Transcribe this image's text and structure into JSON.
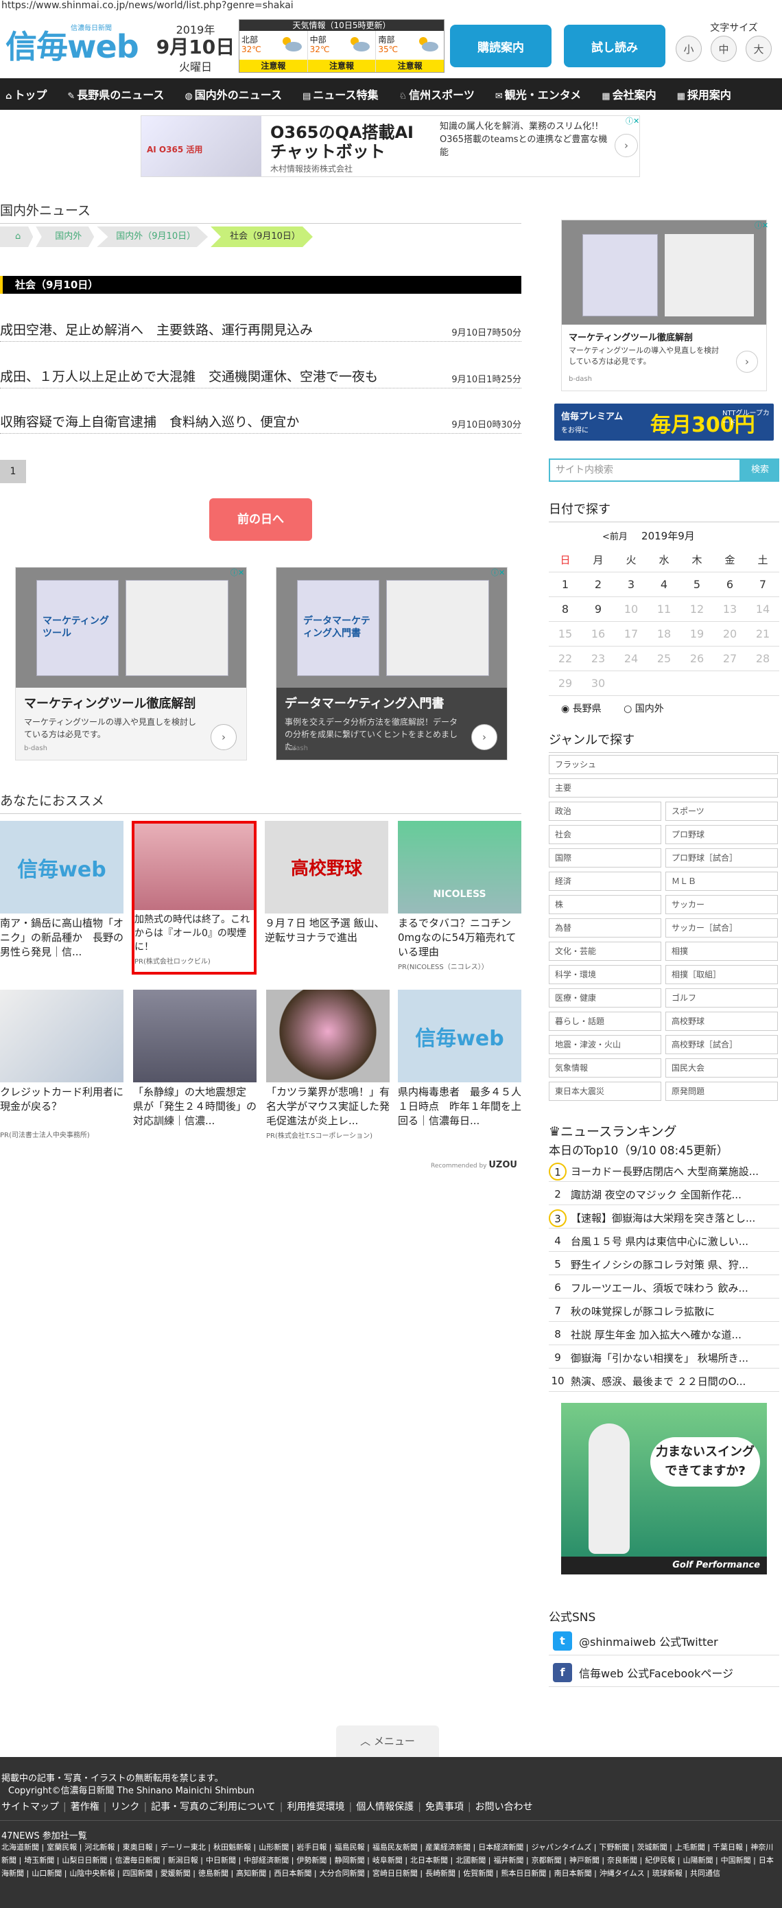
{
  "url": "https://www.shinmai.co.jp/news/world/list.php?genre=shakai",
  "header": {
    "logo_small": "信濃毎日新聞",
    "logo_big": "信毎web",
    "year": "2019年",
    "monthday": "9月10日",
    "weekday": "火曜日",
    "weather_title": "天気情報（10日5時更新）",
    "weather": [
      {
        "area": "北部",
        "temp": "32℃",
        "warn": "注意報"
      },
      {
        "area": "中部",
        "temp": "32℃",
        "warn": "注意報"
      },
      {
        "area": "南部",
        "temp": "35℃",
        "warn": "注意報"
      }
    ],
    "btn_subscribe": "購読案内",
    "btn_trial": "試し読み",
    "font_size_label": "文字サイズ",
    "font_sizes": [
      "小",
      "中",
      "大"
    ]
  },
  "nav": [
    {
      "icon": "home-icon",
      "label": "トップ"
    },
    {
      "icon": "news-icon",
      "label": "長野県のニュース"
    },
    {
      "icon": "globe-icon",
      "label": "国内外のニュース"
    },
    {
      "icon": "doc-icon",
      "label": "ニュース特集"
    },
    {
      "icon": "sports-icon",
      "label": "信州スポーツ"
    },
    {
      "icon": "camera-icon",
      "label": "観光・エンタメ"
    },
    {
      "icon": "building-icon",
      "label": "会社案内"
    },
    {
      "icon": "people-icon",
      "label": "採用案内"
    }
  ],
  "top_ad": {
    "title_l1": "O365のQA搭載AI",
    "title_l2": "チャットボット",
    "company": "木村情報技術株式会社",
    "desc": "知識の属人化を解消、業務のスリム化!!　O365搭載のteamsとの連携など豊富な機能",
    "img_text": "AI O365 活用"
  },
  "main": {
    "section_title": "国内外ニュース",
    "breadcrumb": [
      "国内外",
      "国内外（9月10日）",
      "社会（9月10日）"
    ],
    "genre_header": "社会（9月10日）",
    "articles": [
      {
        "title": "成田空港、足止め解消へ　主要鉄路、運行再開見込み",
        "date": "9月10日7時50分"
      },
      {
        "title": "成田、１万人以上足止めで大混雑　交通機関運休、空港で一夜も",
        "date": "9月10日1時25分"
      },
      {
        "title": "収賄容疑で海上自衛官逮捕　食料納入巡り、便宜か",
        "date": "9月10日0時30分"
      }
    ],
    "page": "1",
    "prev_day": "前の日へ"
  },
  "ad_cards": [
    {
      "title": "マーケティングツール徹底解剖",
      "desc": "マーケティングツールの導入や見直しを検討している方は必見です。",
      "src": "b-dash",
      "book": "マーケティングツール"
    },
    {
      "title": "データマーケティング入門書",
      "desc": "事例を交えデータ分析方法を徹底解説！データの分析を成果に繋げていくヒントをまとめました。",
      "src": "b-dash",
      "book": "データマーケティング入門書"
    }
  ],
  "recommend": {
    "title": "あなたにおススメ",
    "items": [
      {
        "text": "南ア・鍋岳に高山植物「オニク」の新品種か　長野の男性ら発見｜信...",
        "pr": ""
      },
      {
        "text": "加熱式の時代は終了。これからは『オール0』の喫煙に！",
        "pr": "PR(株式会社ロックビル)"
      },
      {
        "text": "９月７日 地区予選 飯山、逆転サヨナラで進出",
        "pr": "",
        "img": "高校野球"
      },
      {
        "text": "まるでタバコ？ニコチン0mgなのに54万箱売れている理由",
        "pr": "PR(NICOLESS（ニコレス））",
        "img": "NICOLESS"
      },
      {
        "text": "クレジットカード利用者に現金が戻る？",
        "pr": "PR(司法書士法人中央事務所)"
      },
      {
        "text": "「糸静線」の大地震想定　県が「発生２４時間後」の対応訓練｜信濃...",
        "pr": ""
      },
      {
        "text": "「カツラ業界が悲鳴！」有名大学がマウス実証した発毛促進法が炎上レ...",
        "pr": "PR(株式会社T.Sコーポレーション)"
      },
      {
        "text": "県内梅毒患者　最多４５人　１日時点　昨年１年間を上回る｜信濃毎日...",
        "pr": ""
      }
    ],
    "recommended_by": "Recommended by",
    "uzou": "UZOU"
  },
  "sidebar": {
    "ad": {
      "title": "マーケティングツール徹底解剖",
      "desc": "マーケティングツールの導入や見直しを検討している方は必見です。",
      "src": "b-dash"
    },
    "premium": {
      "l1": "信毎プレミアム",
      "l2": "をお得に",
      "big": "毎月300円",
      "sm": "NTTグループカード"
    },
    "search_placeholder": "サイト内検索",
    "search_btn": "検索",
    "date_title": "日付で探す",
    "cal_prev": "<前月",
    "cal_month": "2019年9月",
    "cal_head": [
      "日",
      "月",
      "火",
      "水",
      "木",
      "金",
      "土"
    ],
    "cal_rows": [
      [
        "1",
        "2",
        "3",
        "4",
        "5",
        "6",
        "7"
      ],
      [
        "8",
        "9",
        "10",
        "11",
        "12",
        "13",
        "14"
      ],
      [
        "15",
        "16",
        "17",
        "18",
        "19",
        "20",
        "21"
      ],
      [
        "22",
        "23",
        "24",
        "25",
        "26",
        "27",
        "28"
      ],
      [
        "29",
        "30",
        "",
        "",
        "",
        "",
        ""
      ]
    ],
    "radio": [
      "長野県",
      "国内外"
    ],
    "genre_title": "ジャンルで探す",
    "genres_full": [
      "フラッシュ",
      "主要"
    ],
    "genres": [
      [
        "政治",
        "スポーツ"
      ],
      [
        "社会",
        "プロ野球"
      ],
      [
        "国際",
        "プロ野球［試合］"
      ],
      [
        "経済",
        "ＭＬＢ"
      ],
      [
        "株",
        "サッカー"
      ],
      [
        "為替",
        "サッカー［試合］"
      ],
      [
        "文化・芸能",
        "相撲"
      ],
      [
        "科学・環境",
        "相撲［取組］"
      ],
      [
        "医療・健康",
        "ゴルフ"
      ],
      [
        "暮らし・話題",
        "高校野球"
      ],
      [
        "地震・津波・火山",
        "高校野球［試合］"
      ],
      [
        "気象情報",
        "国民大会"
      ],
      [
        "東日本大震災",
        "原発問題"
      ]
    ],
    "ranking_title": "ニュースランキング",
    "ranking_sub": "本日のTop10（9/10 08:45更新）",
    "ranking": [
      "ヨーカドー長野店閉店へ 大型商業施設...",
      "諏訪湖 夜空のマジック 全国新作花...",
      "【速報】御嶽海は大栄翔を突き落とし...",
      "台風１５号 県内は東信中心に激しい...",
      "野生イノシシの豚コレラ対策 県、狩...",
      "フルーツエール、須坂で味わう 飲み...",
      "秋の味覚探しが豚コレラ拡散に",
      "社説 厚生年金 加入拡大へ確かな道...",
      "御嶽海「引かない相撲を」 秋場所き...",
      "熱演、感涙、最後まで ２２日間のO..."
    ],
    "golf_ad": {
      "l1": "力まないスイング",
      "l2": "できてますか?",
      "brand": "Golf Performance"
    },
    "sns_title": "公式SNS",
    "sns": [
      {
        "icon": "twitter-icon",
        "label": "@shinmaiweb 公式Twitter",
        "color": "#1da1f2",
        "g": "t"
      },
      {
        "icon": "facebook-icon",
        "label": "信毎web 公式Facebookページ",
        "color": "#3b5998",
        "g": "f"
      }
    ]
  },
  "footer": {
    "menu": "メニュー",
    "notice": "掲載中の記事・写真・イラストの無断転用を禁じます。",
    "copyright": "Copyright©信濃毎日新聞 The Shinano Mainichi Shimbun",
    "links": [
      "サイトマップ",
      "著作権",
      "リンク",
      "記事・写真のご利用について",
      "利用推奨環境",
      "個人情報保護",
      "免責事項",
      "お問い合わせ"
    ],
    "news_head": "47NEWS 参加社一覧",
    "papers": [
      "北海道新聞",
      "室蘭民報",
      "河北新報",
      "東奥日報",
      "デーリー東北",
      "秋田魁新報",
      "山形新聞",
      "岩手日報",
      "福島民報",
      "福島民友新聞",
      "産業経済新聞",
      "日本経済新聞",
      "ジャパンタイムズ",
      "下野新聞",
      "茨城新聞",
      "上毛新聞",
      "千葉日報",
      "神奈川新聞",
      "埼玉新聞",
      "山梨日日新聞",
      "信濃毎日新聞",
      "新潟日報",
      "中日新聞",
      "中部経済新聞",
      "伊勢新聞",
      "静岡新聞",
      "岐阜新聞",
      "北日本新聞",
      "北國新聞",
      "福井新聞",
      "京都新聞",
      "神戸新聞",
      "奈良新聞",
      "紀伊民報",
      "山陽新聞",
      "中国新聞",
      "日本海新聞",
      "山口新聞",
      "山陰中央新報",
      "四国新聞",
      "愛媛新聞",
      "徳島新聞",
      "高知新聞",
      "西日本新聞",
      "大分合同新聞",
      "宮崎日日新聞",
      "長崎新聞",
      "佐賀新聞",
      "熊本日日新聞",
      "南日本新聞",
      "沖縄タイムス",
      "琉球新報",
      "共同通信"
    ]
  }
}
